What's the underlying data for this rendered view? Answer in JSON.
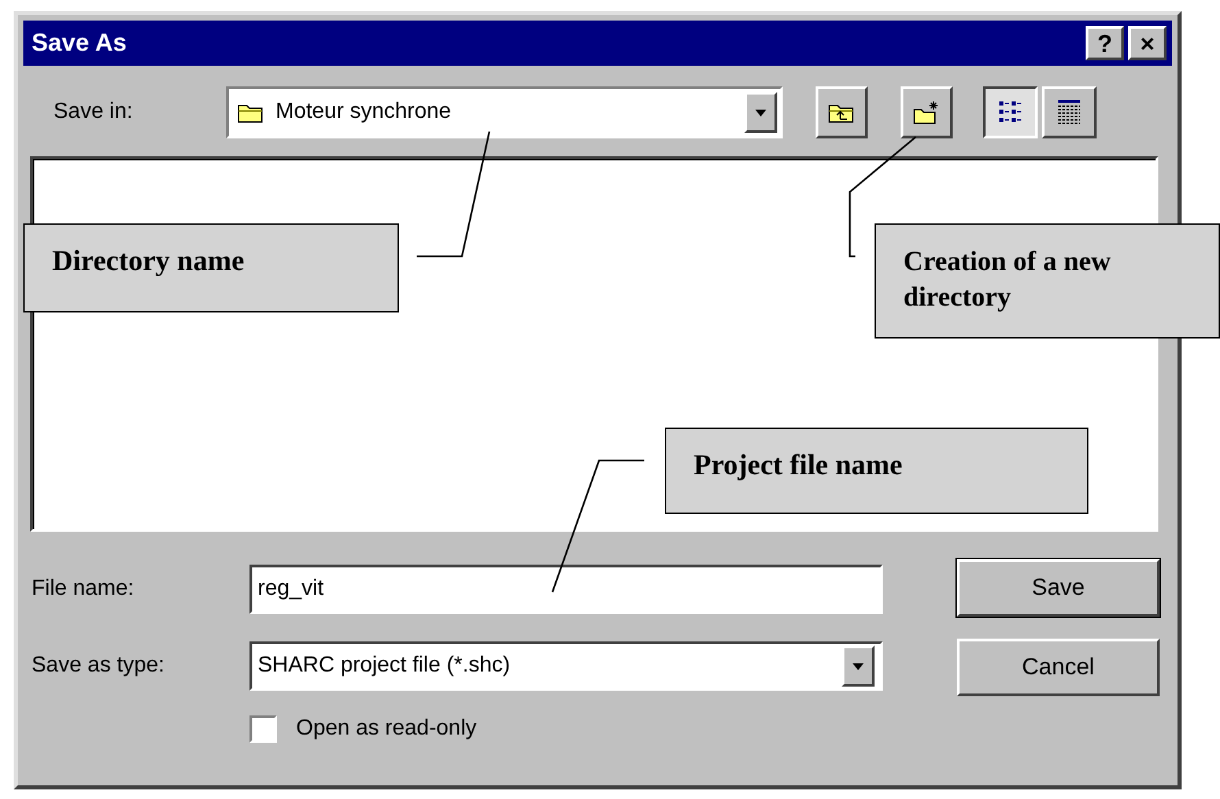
{
  "window": {
    "title": "Save As",
    "title_buttons": [
      "?",
      "×"
    ]
  },
  "save_in": {
    "label": "Save in:",
    "value": "Moteur synchrone"
  },
  "view_buttons": [
    {
      "kind": "list",
      "selected": true
    },
    {
      "kind": "details",
      "selected": false
    }
  ],
  "file_name": {
    "label": "File name:",
    "value": "reg_vit"
  },
  "save_as_type": {
    "label": "Save as type:",
    "value": "SHARC project file (*.shc)"
  },
  "read_only": {
    "label": "Open as read-only",
    "checked": false
  },
  "buttons": [
    {
      "label": "Save",
      "default": true
    },
    {
      "label": "Cancel",
      "default": false
    }
  ],
  "callouts": [
    {
      "text": "Directory name"
    },
    {
      "text": "Creation of a new directory"
    },
    {
      "text": "Project file name"
    }
  ]
}
